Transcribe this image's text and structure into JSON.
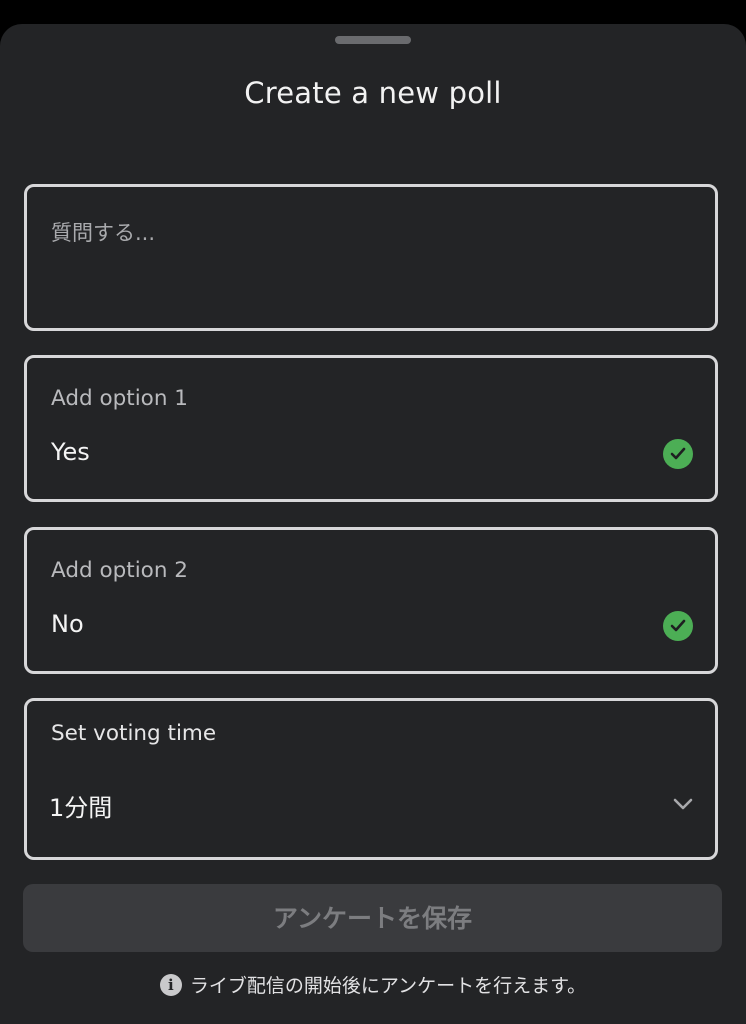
{
  "dialog": {
    "title": "Create a new poll"
  },
  "question": {
    "placeholder": "質問する..."
  },
  "options": [
    {
      "label": "Add option 1",
      "value": "Yes",
      "status_icon": "check-circle-icon",
      "status_color": "#4cae55"
    },
    {
      "label": "Add option 2",
      "value": "No",
      "status_icon": "check-circle-icon",
      "status_color": "#4cae55"
    }
  ],
  "voting_time": {
    "label": "Set voting time",
    "selected": "1分間",
    "icon": "chevron-down-icon"
  },
  "save_button": {
    "label": "アンケートを保存"
  },
  "info": {
    "icon": "info-icon",
    "text": "ライブ配信の開始後にアンケートを行えます。"
  },
  "colors": {
    "sheet_bg": "#232426",
    "accent_check": "#4cae55",
    "disabled_button_bg": "#3a3b3e"
  }
}
